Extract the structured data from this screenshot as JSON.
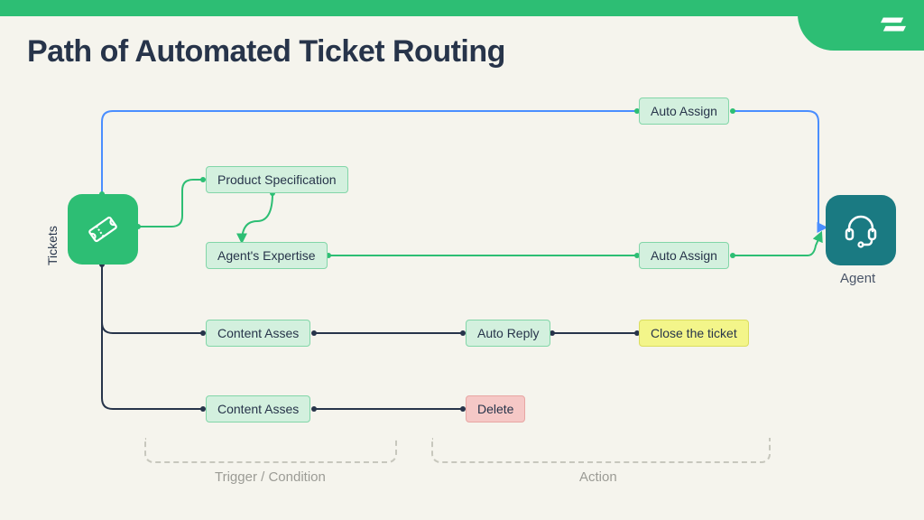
{
  "title": "Path of Automated Ticket Routing",
  "tickets_label": "Tickets",
  "agent_label": "Agent",
  "nodes": {
    "auto_assign_top": "Auto Assign",
    "product_spec": "Product Specification",
    "agent_expertise": "Agent's Expertise",
    "auto_assign_mid": "Auto Assign",
    "content_asses_1": "Content Asses",
    "auto_reply": "Auto Reply",
    "close_ticket": "Close the ticket",
    "content_asses_2": "Content Asses",
    "delete": "Delete"
  },
  "brackets": {
    "trigger": "Trigger / Condition",
    "action": "Action"
  }
}
